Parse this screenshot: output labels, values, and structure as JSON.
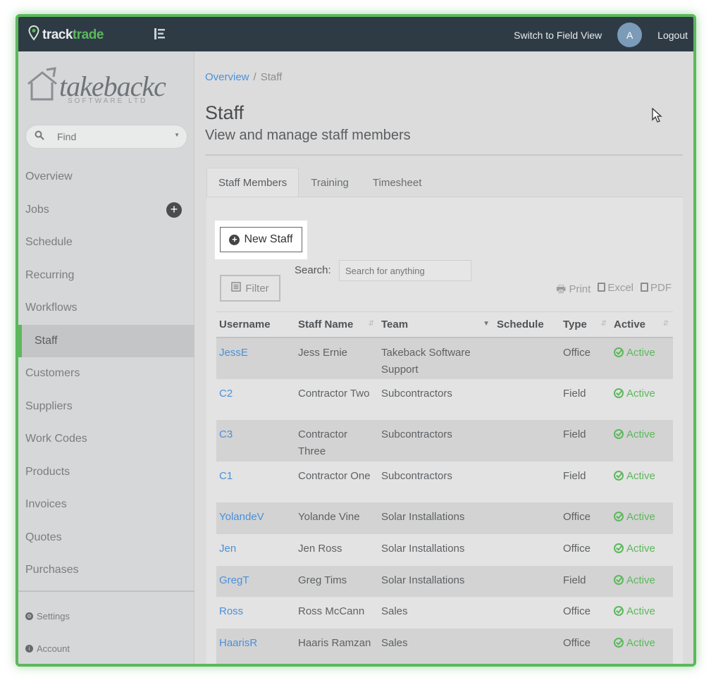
{
  "topbar": {
    "logo_part1": "track",
    "logo_part2": "trade",
    "switch_view": "Switch to Field View",
    "avatar_initial": "A",
    "logout": "Logout"
  },
  "sidebar": {
    "brand_name": "takebackc",
    "brand_sub": "SOFTWARE LTD",
    "find_placeholder": "Find",
    "items": [
      {
        "label": "Overview"
      },
      {
        "label": "Jobs"
      },
      {
        "label": "Schedule"
      },
      {
        "label": "Recurring"
      },
      {
        "label": "Workflows"
      },
      {
        "label": "Staff"
      },
      {
        "label": "Customers"
      },
      {
        "label": "Suppliers"
      },
      {
        "label": "Work Codes"
      },
      {
        "label": "Products"
      },
      {
        "label": "Invoices"
      },
      {
        "label": "Quotes"
      },
      {
        "label": "Purchases"
      }
    ],
    "settings": "Settings",
    "account": "Account"
  },
  "breadcrumb": {
    "parent": "Overview",
    "separator": "/",
    "current": "Staff"
  },
  "page": {
    "title": "Staff",
    "subtitle": "View and manage staff members"
  },
  "tabs": [
    {
      "label": "Staff Members"
    },
    {
      "label": "Training"
    },
    {
      "label": "Timesheet"
    }
  ],
  "toolbar": {
    "new_staff": "New Staff",
    "search_label": "Search:",
    "search_placeholder": "Search for anything",
    "filter": "Filter",
    "print": "Print",
    "excel": "Excel",
    "pdf": "PDF"
  },
  "table": {
    "columns": [
      "Username",
      "Staff Name",
      "Team",
      "Schedule",
      "Type",
      "Active"
    ],
    "rows": [
      {
        "username": "JessE",
        "name": "Jess Ernie",
        "team": "Takeback Software Support",
        "schedule": "",
        "type": "Office",
        "active": "Active"
      },
      {
        "username": "C2",
        "name": "Contractor Two",
        "team": "Subcontractors",
        "schedule": "",
        "type": "Field",
        "active": "Active"
      },
      {
        "username": "C3",
        "name": "Contractor Three",
        "team": "Subcontractors",
        "schedule": "",
        "type": "Field",
        "active": "Active"
      },
      {
        "username": "C1",
        "name": "Contractor One",
        "team": "Subcontractors",
        "schedule": "",
        "type": "Field",
        "active": "Active"
      },
      {
        "username": "YolandeV",
        "name": "Yolande Vine",
        "team": "Solar Installations",
        "schedule": "",
        "type": "Office",
        "active": "Active"
      },
      {
        "username": "Jen",
        "name": "Jen Ross",
        "team": "Solar Installations",
        "schedule": "",
        "type": "Office",
        "active": "Active"
      },
      {
        "username": "GregT",
        "name": "Greg Tims",
        "team": "Solar Installations",
        "schedule": "",
        "type": "Field",
        "active": "Active"
      },
      {
        "username": "Ross",
        "name": "Ross McCann",
        "team": "Sales",
        "schedule": "",
        "type": "Office",
        "active": "Active"
      },
      {
        "username": "HaarisR",
        "name": "Haaris Ramzan",
        "team": "Sales",
        "schedule": "",
        "type": "Office",
        "active": "Active"
      }
    ]
  },
  "colors": {
    "accent": "#5cb85c",
    "link": "#4a90d9",
    "topbar": "#2e3b45"
  }
}
